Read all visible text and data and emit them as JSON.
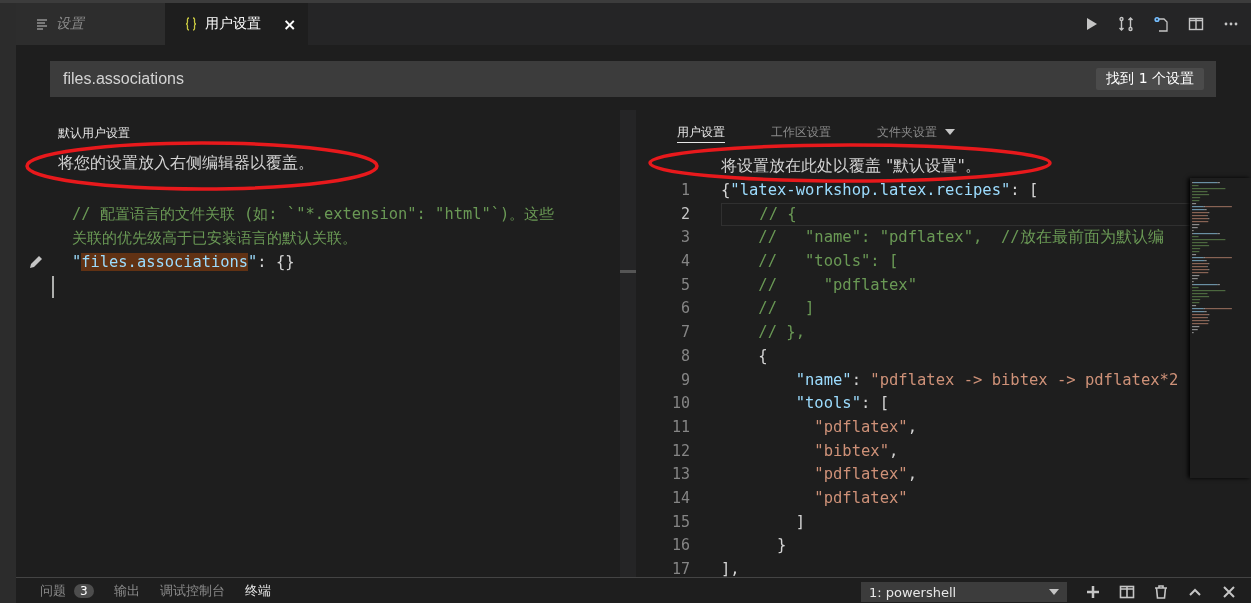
{
  "tabs": [
    {
      "label": "设置",
      "kind": "settings",
      "selected": false
    },
    {
      "label": "用户设置",
      "kind": "json",
      "selected": true,
      "closable": "×"
    }
  ],
  "search": {
    "value": "files.associations",
    "result": "找到 1 个设置"
  },
  "default_pane": {
    "header": "默认用户设置",
    "banner": "将您的设置放入右侧编辑器以覆盖。",
    "lines": [
      [
        {
          "kind": "comment",
          "text": "// 配置语言的文件关联 (如: `\"*.extension\": \"html\"`)。这些"
        }
      ],
      [
        {
          "kind": "comment",
          "text": "关联的优先级高于已安装语言的默认关联。"
        }
      ],
      [
        {
          "kind": "key",
          "text": "\""
        },
        {
          "kind": "key",
          "text": "files.associations",
          "highlighted": true
        },
        {
          "kind": "key",
          "text": "\""
        },
        {
          "kind": "punct",
          "text": ": {}"
        }
      ]
    ]
  },
  "user_pane": {
    "tabs": [
      {
        "label": "用户设置",
        "selected": true
      },
      {
        "label": "工作区设置",
        "selected": false
      },
      {
        "label": "文件夹设置",
        "selected": false,
        "dropdown": true
      }
    ],
    "banner": "将设置放在此处以覆盖 \"默认设置\"。",
    "lines": [
      {
        "number": "1",
        "current": false,
        "tokens": [
          {
            "kind": "punct",
            "text": "{"
          },
          {
            "kind": "key",
            "text": "\"latex-workshop.latex.recipes\""
          },
          {
            "kind": "punct",
            "text": ": ["
          }
        ]
      },
      {
        "number": "2",
        "current": true,
        "tokens": [
          {
            "kind": "comment",
            "text": "    // {"
          }
        ]
      },
      {
        "number": "3",
        "current": false,
        "tokens": [
          {
            "kind": "comment",
            "text": "    //   \"name\": \"pdflatex\",  //放在最前面为默认编"
          }
        ]
      },
      {
        "number": "4",
        "current": false,
        "tokens": [
          {
            "kind": "comment",
            "text": "    //   \"tools\": ["
          }
        ]
      },
      {
        "number": "5",
        "current": false,
        "tokens": [
          {
            "kind": "comment",
            "text": "    //     \"pdflatex\""
          }
        ]
      },
      {
        "number": "6",
        "current": false,
        "tokens": [
          {
            "kind": "comment",
            "text": "    //   ]"
          }
        ]
      },
      {
        "number": "7",
        "current": false,
        "tokens": [
          {
            "kind": "comment",
            "text": "    // },"
          }
        ]
      },
      {
        "number": "8",
        "current": false,
        "tokens": [
          {
            "kind": "punct",
            "text": "    {"
          }
        ]
      },
      {
        "number": "9",
        "current": false,
        "tokens": [
          {
            "kind": "key",
            "text": "        \"name\""
          },
          {
            "kind": "punct",
            "text": ": "
          },
          {
            "kind": "string",
            "text": "\"pdflatex -> bibtex -> pdflatex*2"
          }
        ]
      },
      {
        "number": "10",
        "current": false,
        "tokens": [
          {
            "kind": "key",
            "text": "        \"tools\""
          },
          {
            "kind": "punct",
            "text": ": ["
          }
        ]
      },
      {
        "number": "11",
        "current": false,
        "tokens": [
          {
            "kind": "string",
            "text": "          \"pdflatex\""
          },
          {
            "kind": "punct",
            "text": ","
          }
        ]
      },
      {
        "number": "12",
        "current": false,
        "tokens": [
          {
            "kind": "string",
            "text": "          \"bibtex\""
          },
          {
            "kind": "punct",
            "text": ","
          }
        ]
      },
      {
        "number": "13",
        "current": false,
        "tokens": [
          {
            "kind": "string",
            "text": "          \"pdflatex\""
          },
          {
            "kind": "punct",
            "text": ","
          }
        ]
      },
      {
        "number": "14",
        "current": false,
        "tokens": [
          {
            "kind": "string",
            "text": "          \"pdflatex\""
          }
        ]
      },
      {
        "number": "15",
        "current": false,
        "tokens": [
          {
            "kind": "punct",
            "text": "        ]"
          }
        ]
      },
      {
        "number": "16",
        "current": false,
        "tokens": [
          {
            "kind": "punct",
            "text": "      }"
          }
        ]
      },
      {
        "number": "17",
        "current": false,
        "tokens": [
          {
            "kind": "punct",
            "text": "],"
          }
        ]
      }
    ]
  },
  "panel": {
    "tabs": [
      {
        "label": "问题",
        "badge": "3",
        "selected": false
      },
      {
        "label": "输出",
        "selected": false
      },
      {
        "label": "调试控制台",
        "selected": false
      },
      {
        "label": "终端",
        "selected": true
      }
    ],
    "terminal": "1: powershell"
  }
}
